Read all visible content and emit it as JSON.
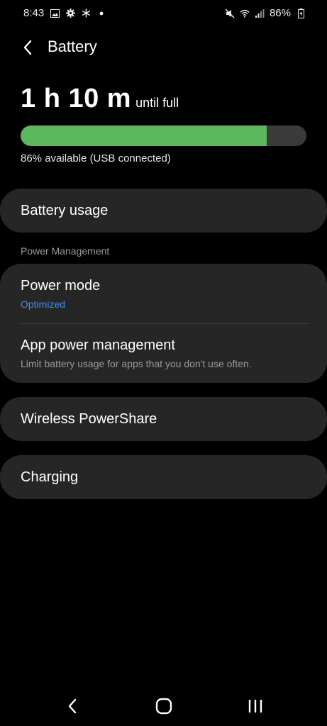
{
  "status_bar": {
    "time": "8:43",
    "battery_percent": "86%",
    "left_icons": [
      "gallery-icon",
      "settings-gear-icon",
      "snowflake-icon",
      "dot-icon"
    ],
    "right_icons": [
      "mute-icon",
      "wifi-icon",
      "signal-icon",
      "battery-charging-icon"
    ]
  },
  "header": {
    "title": "Battery"
  },
  "summary": {
    "time_value": "1 h 10 m",
    "time_suffix": "until full",
    "level": 0.86,
    "available_text": "86% available (USB connected)",
    "bar_color": "#5cb85c",
    "track_color": "#3a3a3a"
  },
  "items": {
    "battery_usage": "Battery usage",
    "section_label": "Power Management",
    "power_mode": {
      "title": "Power mode",
      "subtitle": "Optimized"
    },
    "app_power": {
      "title": "App power management",
      "subtitle": "Limit battery usage for apps that you don't use often."
    },
    "wireless_powershare": "Wireless PowerShare",
    "charging": "Charging"
  },
  "colors": {
    "accent": "#3d8ff0",
    "card": "#262626",
    "background": "#000000"
  },
  "nav": {
    "icons": [
      "back-icon",
      "home-icon",
      "recents-icon"
    ]
  }
}
